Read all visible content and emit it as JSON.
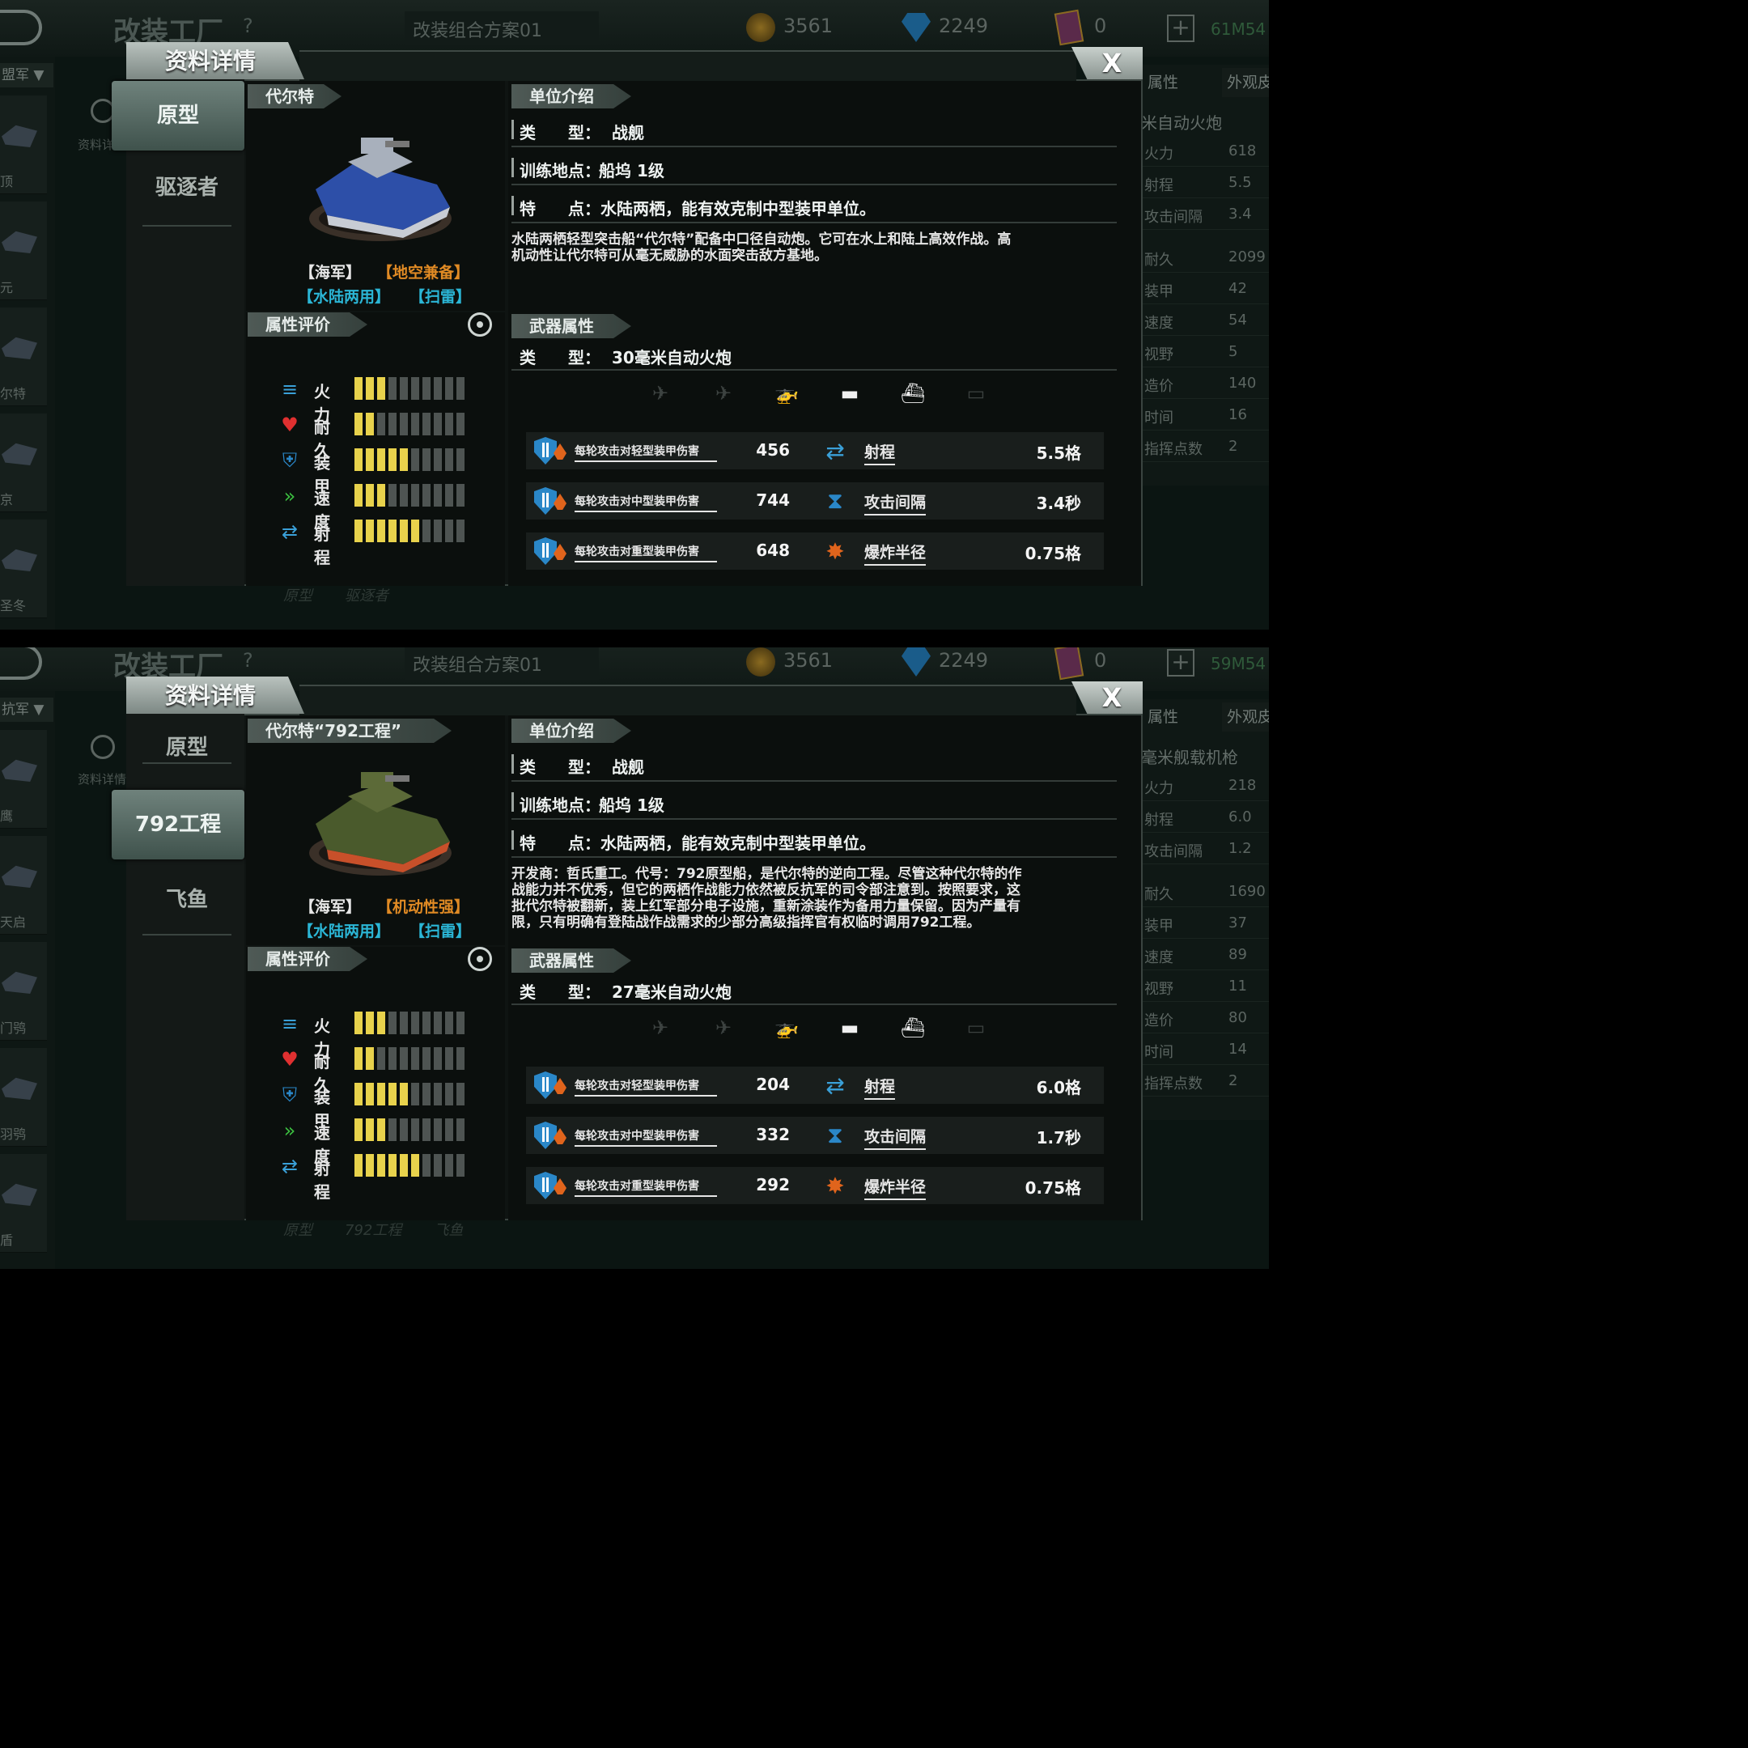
{
  "panels": [
    {
      "bg": {
        "title": "改装工厂",
        "help": "?",
        "plan": "改装组合方案01",
        "gold": "3561",
        "gems": "2249",
        "cards": "0",
        "memory": "61M54",
        "faction": "盟军",
        "units": [
          "顶",
          "元",
          "尔特",
          "京",
          "圣冬"
        ],
        "zoom_label": "资料详",
        "right_tabs": [
          "属性",
          "外观皮"
        ],
        "right_title": "米自动火炮",
        "right_rows": [
          [
            "火力",
            "618"
          ],
          [
            "射程",
            "5.5"
          ],
          [
            "攻击间隔",
            "3.4"
          ],
          [
            "耐久",
            "2099"
          ],
          [
            "装甲",
            "42"
          ],
          [
            "速度",
            "54"
          ],
          [
            "视野",
            "5"
          ],
          [
            "造价",
            "140"
          ],
          [
            "时间",
            "16"
          ],
          [
            "指挥点数",
            "2"
          ]
        ],
        "bottom": [
          "原型",
          "驱逐者"
        ]
      },
      "modal_title": "资料详情",
      "close": "X",
      "tabs": [
        "原型",
        "驱逐者"
      ],
      "active_tab": 0,
      "unit_name": "代尔特",
      "tags": [
        "【海军】",
        "【地空兼备】",
        "【水陆两用】",
        "【扫雷】"
      ],
      "rating_header": "属性评价",
      "stats": [
        {
          "name": "火力",
          "level": 3
        },
        {
          "name": "耐久",
          "level": 2
        },
        {
          "name": "装甲",
          "level": 5
        },
        {
          "name": "速度",
          "level": 3
        },
        {
          "name": "射程",
          "level": 6
        }
      ],
      "intro_header": "单位介绍",
      "info": [
        {
          "k": "类　　型：",
          "v": "战舰"
        },
        {
          "k": "训练地点：",
          "v": "船坞 1级"
        },
        {
          "k": "特　　点：",
          "v": "水陆两栖，能有效克制中型装甲单位。"
        }
      ],
      "desc": [
        "水陆两栖轻型突击船“代尔特”配备中口径自动炮。它可在水上和陆上高效作战。高",
        "机动性让代尔特可从毫无威胁的水面突击敌方基地。"
      ],
      "weapon_header": "武器属性",
      "weapon_type_label": "类　　型：",
      "weapon_type": "30毫米自动火炮",
      "targets": [
        {
          "icon": "fighter-jet",
          "on": false
        },
        {
          "icon": "bomber",
          "on": false
        },
        {
          "icon": "helicopter",
          "on": true
        },
        {
          "icon": "tank",
          "on": true
        },
        {
          "icon": "ship",
          "on": true
        },
        {
          "icon": "submarine",
          "on": false
        }
      ],
      "weapon_rows": [
        {
          "label": "每轮攻击对轻型装甲伤害",
          "value": "456",
          "label2": "射程",
          "value2": "5.5格"
        },
        {
          "label": "每轮攻击对中型装甲伤害",
          "value": "744",
          "label2": "攻击间隔",
          "value2": "3.4秒"
        },
        {
          "label": "每轮攻击对重型装甲伤害",
          "value": "648",
          "label2": "爆炸半径",
          "value2": "0.75格"
        }
      ]
    },
    {
      "bg": {
        "title": "改装工厂",
        "help": "?",
        "plan": "改装组合方案01",
        "gold": "3561",
        "gems": "2249",
        "cards": "0",
        "memory": "59M54",
        "faction": "抗军",
        "units": [
          "鹰",
          "天启",
          "门鸮",
          "羽鸮",
          "盾"
        ],
        "zoom_label": "资料详情",
        "right_tabs": [
          "属性",
          "外观皮"
        ],
        "right_title": "毫米舰载机枪",
        "right_rows": [
          [
            "火力",
            "218"
          ],
          [
            "射程",
            "6.0"
          ],
          [
            "攻击间隔",
            "1.2"
          ],
          [
            "耐久",
            "1690"
          ],
          [
            "装甲",
            "37"
          ],
          [
            "速度",
            "89"
          ],
          [
            "视野",
            "11"
          ],
          [
            "造价",
            "80"
          ],
          [
            "时间",
            "14"
          ],
          [
            "指挥点数",
            "2"
          ]
        ],
        "bottom": [
          "原型",
          "792工程",
          "飞鱼"
        ]
      },
      "modal_title": "资料详情",
      "close": "X",
      "tabs": [
        "原型",
        "792工程",
        "飞鱼"
      ],
      "active_tab": 1,
      "unit_name": "代尔特“792工程”",
      "tags": [
        "【海军】",
        "【机动性强】",
        "【水陆两用】",
        "【扫雷】"
      ],
      "rating_header": "属性评价",
      "stats": [
        {
          "name": "火力",
          "level": 3
        },
        {
          "name": "耐久",
          "level": 2
        },
        {
          "name": "装甲",
          "level": 5
        },
        {
          "name": "速度",
          "level": 3
        },
        {
          "name": "射程",
          "level": 6
        }
      ],
      "intro_header": "单位介绍",
      "info": [
        {
          "k": "类　　型：",
          "v": "战舰"
        },
        {
          "k": "训练地点：",
          "v": "船坞 1级"
        },
        {
          "k": "特　　点：",
          "v": "水陆两栖，能有效克制中型装甲单位。"
        }
      ],
      "desc": [
        "开发商：哲氏重工。代号：792原型船，是代尔特的逆向工程。尽管这种代尔特的作",
        "战能力并不优秀，但它的两栖作战能力依然被反抗军的司令部注意到。按照要求，这",
        "批代尔特被翻新，装上红军部分电子设施，重新涂装作为备用力量保留。因为产量有",
        "限，只有明确有登陆战作战需求的少部分高级指挥官有权临时调用792工程。"
      ],
      "weapon_header": "武器属性",
      "weapon_type_label": "类　　型：",
      "weapon_type": "27毫米自动火炮",
      "targets": [
        {
          "icon": "fighter-jet",
          "on": false
        },
        {
          "icon": "bomber",
          "on": false
        },
        {
          "icon": "helicopter",
          "on": true
        },
        {
          "icon": "tank",
          "on": true
        },
        {
          "icon": "ship",
          "on": true
        },
        {
          "icon": "submarine",
          "on": false
        }
      ],
      "weapon_rows": [
        {
          "label": "每轮攻击对轻型装甲伤害",
          "value": "204",
          "label2": "射程",
          "value2": "6.0格"
        },
        {
          "label": "每轮攻击对中型装甲伤害",
          "value": "332",
          "label2": "攻击间隔",
          "value2": "1.7秒"
        },
        {
          "label": "每轮攻击对重型装甲伤害",
          "value": "292",
          "label2": "爆炸半径",
          "value2": "0.75格"
        }
      ]
    }
  ]
}
